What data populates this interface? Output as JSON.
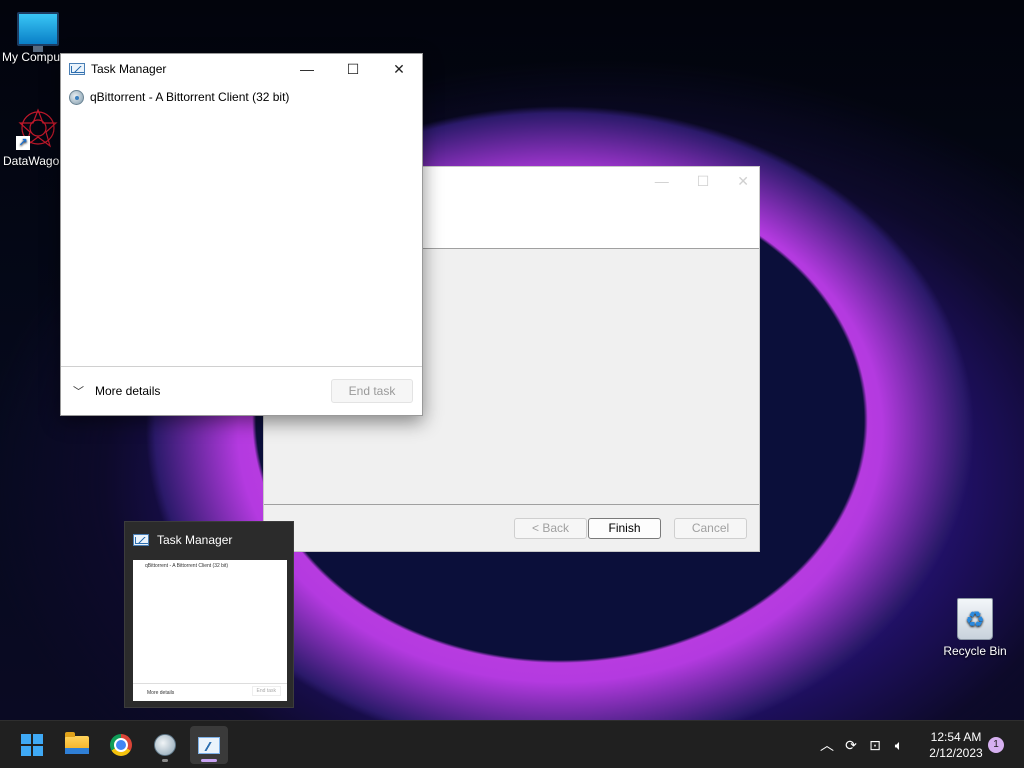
{
  "desktop": {
    "icons": [
      {
        "label": "My Computer",
        "icon": "monitor-icon"
      },
      {
        "label": "DataWagon",
        "icon": "datawagon-icon"
      },
      {
        "label": "Recycle Bin",
        "icon": "recycle-bin-icon"
      }
    ]
  },
  "wizard": {
    "back_label": "< Back",
    "finish_label": "Finish",
    "cancel_label": "Cancel"
  },
  "task_manager": {
    "title": "Task Manager",
    "process": "qBittorrent - A Bittorrent Client (32 bit)",
    "more_details": "More details",
    "end_task": "End task",
    "minimize_glyph": "—",
    "maximize_glyph": "☐",
    "close_glyph": "✕"
  },
  "thumbnail": {
    "title": "Task Manager",
    "process": "qBittorrent - A Bittorrent Client (32 bit)",
    "more_details": "More details",
    "end_task": "End task"
  },
  "taskbar": {
    "apps": [
      "start-icon",
      "file-explorer-icon",
      "chrome-icon",
      "qbittorrent-icon",
      "task-manager-icon"
    ],
    "clock_time": "12:54 AM",
    "clock_date": "2/12/2023",
    "notification_count": "1"
  },
  "colors": {
    "taskbar_bg": "#202020",
    "active_indicator": "#c7a2f2",
    "accent_blue": "#3fa9f5"
  }
}
